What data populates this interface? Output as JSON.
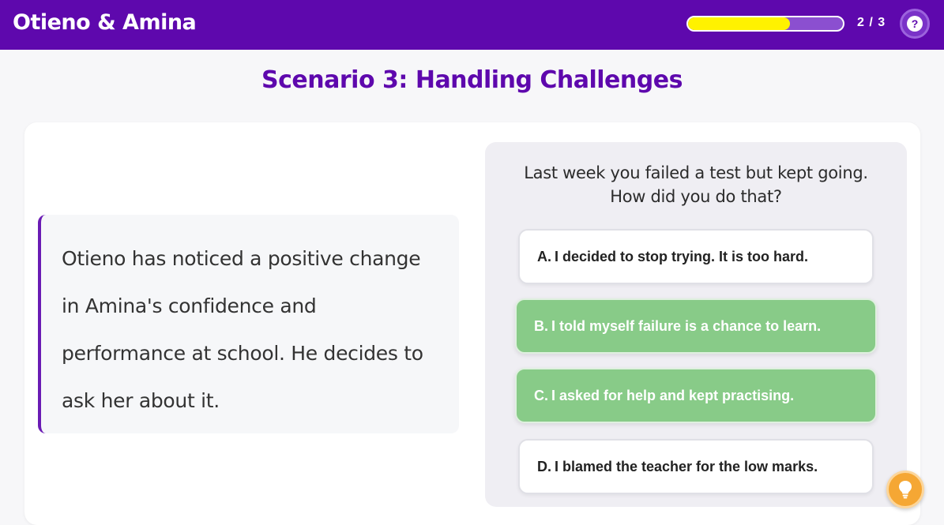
{
  "header": {
    "title": "Otieno & Amina",
    "progress_fraction": 0.66,
    "progress_label": "2 / 3",
    "help_icon": "question-mark-icon",
    "help_glyph": "?"
  },
  "scenario": {
    "title": "Scenario 3: Handling Challenges",
    "story": "Otieno has noticed a positive change in Amina's confidence and performance at school. He decides to ask her about it."
  },
  "question": {
    "line1": "Last week you failed a test but kept going.",
    "line2": "How did you do that?"
  },
  "options": [
    {
      "letter": "A.",
      "text": "I decided to stop trying. It is too hard.",
      "state": "default"
    },
    {
      "letter": "B.",
      "text": "I told myself failure is a chance to learn.",
      "state": "selected"
    },
    {
      "letter": "C.",
      "text": "I asked for help and kept practising.",
      "state": "selected"
    },
    {
      "letter": "D.",
      "text": "I blamed the teacher for the low marks.",
      "state": "default"
    }
  ],
  "hint": {
    "icon": "lightbulb-icon"
  },
  "colors": {
    "brand_purple": "#5e08ad",
    "progress_fill": "#fff200",
    "selected_green": "#88cb88",
    "hint_orange": "#f5a734"
  }
}
